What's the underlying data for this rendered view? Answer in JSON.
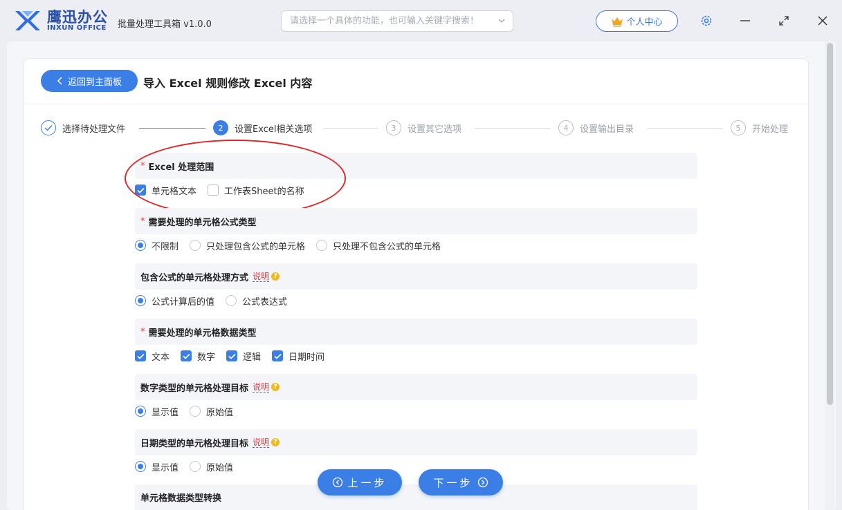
{
  "titlebar": {
    "logo_cn": "鹰迅办公",
    "logo_en": "INXUN OFFICE",
    "app_title": "批量处理工具箱 v1.0.0",
    "search_placeholder": "请选择一个具体的功能，也可输入关键字搜索！",
    "user_center": "个人中心"
  },
  "header": {
    "back_button": "返回到主面板",
    "page_title": "导入 Excel 规则修改 Excel 内容"
  },
  "steps": [
    {
      "num": "1",
      "label": "选择待处理文件",
      "state": "done"
    },
    {
      "num": "2",
      "label": "设置Excel相关选项",
      "state": "active"
    },
    {
      "num": "3",
      "label": "设置其它选项",
      "state": "pending"
    },
    {
      "num": "4",
      "label": "设置输出目录",
      "state": "pending"
    },
    {
      "num": "5",
      "label": "开始处理",
      "state": "pending"
    }
  ],
  "sections": {
    "range": {
      "title": "Excel 处理范围",
      "required": true,
      "options": [
        {
          "label": "单元格文本",
          "checked": true
        },
        {
          "label": "工作表Sheet的名称",
          "checked": false
        }
      ]
    },
    "formula_type": {
      "title": "需要处理的单元格公式类型",
      "required": true,
      "options": [
        {
          "label": "不限制",
          "selected": true
        },
        {
          "label": "只处理包含公式的单元格",
          "selected": false
        },
        {
          "label": "只处理不包含公式的单元格",
          "selected": false
        }
      ]
    },
    "formula_mode": {
      "title": "包含公式的单元格处理方式",
      "help": "说明",
      "options": [
        {
          "label": "公式计算后的值",
          "selected": true
        },
        {
          "label": "公式表达式",
          "selected": false
        }
      ]
    },
    "data_type": {
      "title": "需要处理的单元格数据类型",
      "required": true,
      "options": [
        {
          "label": "文本",
          "checked": true
        },
        {
          "label": "数字",
          "checked": true
        },
        {
          "label": "逻辑",
          "checked": true
        },
        {
          "label": "日期时间",
          "checked": true
        }
      ]
    },
    "number_target": {
      "title": "数字类型的单元格处理目标",
      "help": "说明",
      "options": [
        {
          "label": "显示值",
          "selected": true
        },
        {
          "label": "原始值",
          "selected": false
        }
      ]
    },
    "date_target": {
      "title": "日期类型的单元格处理目标",
      "help": "说明",
      "options": [
        {
          "label": "显示值",
          "selected": true
        },
        {
          "label": "原始值",
          "selected": false
        }
      ]
    },
    "type_convert": {
      "title": "单元格数据类型转换"
    }
  },
  "footer": {
    "prev_button": "上一步",
    "next_button": "下一步"
  },
  "colors": {
    "accent": "#3b7fe6",
    "required_mark": "#e4393c",
    "highlight_ellipse": "#e02626",
    "help_badge": "#f2b81d"
  }
}
